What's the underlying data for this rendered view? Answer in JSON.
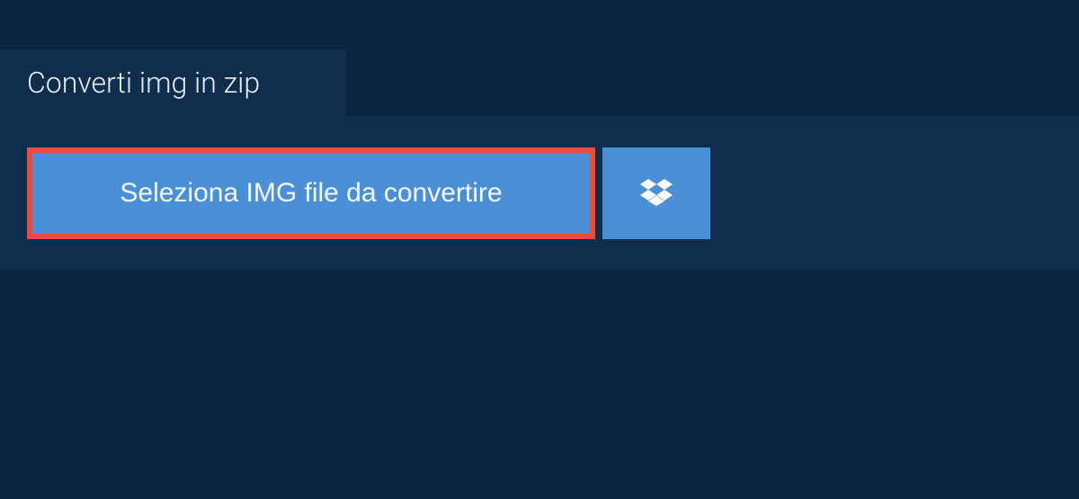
{
  "tab": {
    "label": "Converti img in zip"
  },
  "actions": {
    "selectFileLabel": "Seleziona IMG file da convertire"
  }
}
